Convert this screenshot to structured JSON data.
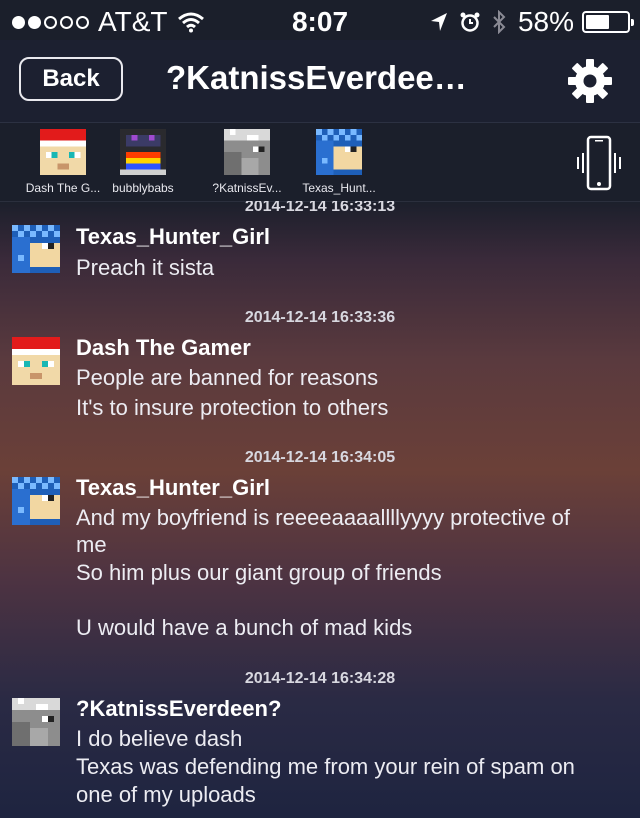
{
  "status_bar": {
    "signal_bars": [
      true,
      true,
      false,
      false,
      false
    ],
    "carrier": "AT&T",
    "time": "8:07",
    "battery": "58%",
    "battery_level": 0.58,
    "icons": [
      "wifi-icon",
      "location-arrow-icon",
      "alarm-icon",
      "bluetooth-icon",
      "battery-icon"
    ]
  },
  "nav": {
    "back_label": "Back",
    "title": "?KatnissEverdeen?",
    "settings_icon": "gear-icon"
  },
  "members": [
    {
      "name": "Dash The Gamer",
      "display": "Dash The G...",
      "avatar": "santa-avatar"
    },
    {
      "name": "bubblybabs",
      "display": "bubblybabs",
      "avatar": "rainbow-avatar"
    },
    {
      "name": "?KatnissEverdeen?",
      "display": "?KatnissEv...",
      "avatar": "gray-avatar"
    },
    {
      "name": "Texas_Hunter_Girl",
      "display": "Texas_Hunt...",
      "avatar": "blue-checker-avatar"
    }
  ],
  "vibrate_icon": "phone-vibrate-icon",
  "messages": [
    {
      "timestamp": "2014-12-14 16:33:13",
      "sender": "Texas_Hunter_Girl",
      "avatar": "blue-checker-avatar",
      "lines": [
        "Preach it sista"
      ]
    },
    {
      "timestamp": "2014-12-14 16:33:36",
      "sender": "Dash The Gamer",
      "avatar": "santa-avatar",
      "lines": [
        "People are banned for reasons",
        "It's to insure protection to others"
      ]
    },
    {
      "timestamp": "2014-12-14 16:34:05",
      "sender": "Texas_Hunter_Girl",
      "avatar": "blue-checker-avatar",
      "lines": [
        "And my boyfriend is reeeeaaaallllyyyy protective of",
        "me",
        "So him plus our giant group of friends",
        "",
        "U would have a bunch of mad kids"
      ]
    },
    {
      "timestamp": "2014-12-14 16:34:28",
      "sender": "?KatnissEverdeen?",
      "avatar": "gray-avatar",
      "lines": [
        "I do believe dash",
        "Texas was defending me from your rein of spam on",
        "one of my uploads"
      ]
    }
  ],
  "colors": {
    "nav_bg": "#1c2030",
    "text": "#ffffff"
  }
}
